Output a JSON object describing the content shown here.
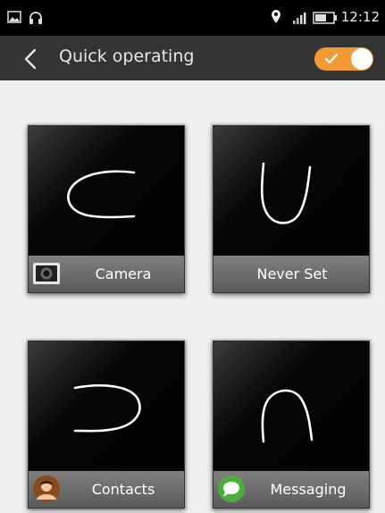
{
  "status_bar": {
    "time": "12:12",
    "icons": [
      "image-icon",
      "headset-icon",
      "location-icon",
      "signal-icon",
      "battery-icon"
    ]
  },
  "app_bar": {
    "title": "Quick operating",
    "back_icon": "back-chevron-icon",
    "toggle": {
      "state": "on",
      "color": "#f39a34"
    }
  },
  "gestures": [
    {
      "shape": "C",
      "app": "Camera",
      "icon": "camera-icon"
    },
    {
      "shape": "U",
      "app": "Never Set",
      "icon": ""
    },
    {
      "shape": "reversed-C",
      "app": "Contacts",
      "icon": "contacts-avatar-icon"
    },
    {
      "shape": "n",
      "app": "Messaging",
      "icon": "messaging-icon"
    }
  ],
  "colors": {
    "status_bar": "#000000",
    "app_bar": "#343434",
    "background": "#f0f0f0",
    "accent": "#f39a34"
  }
}
